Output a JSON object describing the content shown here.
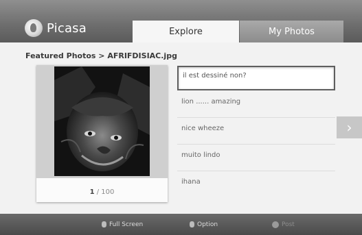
{
  "app": {
    "logo_text": "Picasa"
  },
  "tabs": [
    {
      "label": "Explore",
      "active": true
    },
    {
      "label": "My Photos",
      "active": false
    }
  ],
  "breadcrumb": "Featured Photos > AFRIFDISIAC.jpg",
  "photo": {
    "subject": "lion",
    "counter_current": "1",
    "counter_total": "/ 100"
  },
  "comments": [
    {
      "text": "il est dessiné non?",
      "selected": true
    },
    {
      "text": "lion ...... amazing",
      "selected": false
    },
    {
      "text": "nice wheeze",
      "selected": false
    },
    {
      "text": "muito lindo",
      "selected": false
    },
    {
      "text": "ihana",
      "selected": false
    }
  ],
  "footer": {
    "hints": [
      {
        "label": "Full Screen",
        "icon": "remote-key-icon"
      },
      {
        "label": "Option",
        "icon": "remote-key-icon"
      },
      {
        "label": "Post",
        "icon": "remote-key-icon"
      }
    ]
  },
  "colors": {
    "topbar": "#6d6d6d",
    "active_tab": "#f6f6f6",
    "inactive_tab": "#8c8c8c",
    "bottombar": "#4a4a4a"
  }
}
